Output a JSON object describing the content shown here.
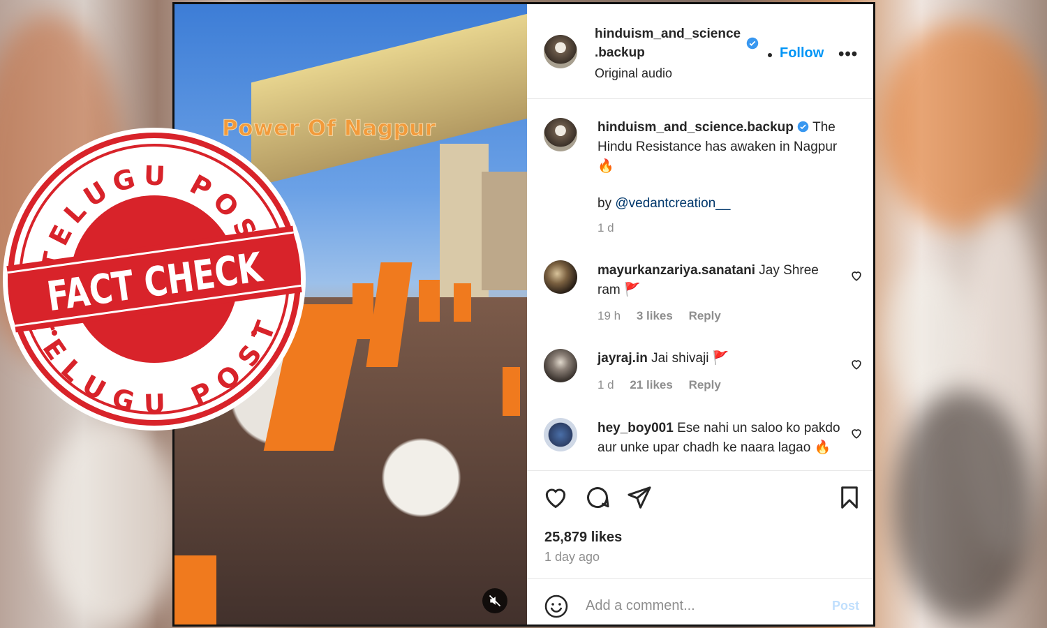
{
  "video": {
    "overlay_title": "Power Of Nagpur",
    "mute_icon": "speaker-muted-icon"
  },
  "stamp": {
    "top_text": "TELUGU POST",
    "center_text": "FACT CHECK",
    "bottom_text": "TELUGU POST",
    "color": "#d8232a"
  },
  "header": {
    "username_line1": "hinduism_and_science",
    "username_line2": ".backup",
    "subtitle": "Original audio",
    "follow_label": "Follow",
    "more_label": "•••"
  },
  "caption": {
    "username": "hinduism_and_science.backup",
    "text": "The Hindu Resistance has awaken in Nagpur 🔥",
    "by_prefix": "by ",
    "mention": "@vedantcreation__",
    "time": "1 d"
  },
  "comments": [
    {
      "username": "mayurkanzariya.sanatani",
      "text": "Jay Shree ram 🚩",
      "time": "19 h",
      "likes": "3 likes",
      "reply": "Reply"
    },
    {
      "username": "jayraj.in",
      "text": "Jai shivaji 🚩",
      "time": "1 d",
      "likes": "21 likes",
      "reply": "Reply"
    },
    {
      "username": "hey_boy001",
      "text": "Ese nahi un saloo ko pakdo aur unke upar chadh ke naara lagao 🔥",
      "time": "",
      "likes": "",
      "reply": ""
    }
  ],
  "stats": {
    "likes": "25,879 likes",
    "posted": "1 day ago"
  },
  "composer": {
    "placeholder": "Add a comment...",
    "post_label": "Post"
  },
  "colors": {
    "accent": "#0095f6",
    "verified": "#3897f0",
    "orange_flag": "#f07a1e"
  }
}
